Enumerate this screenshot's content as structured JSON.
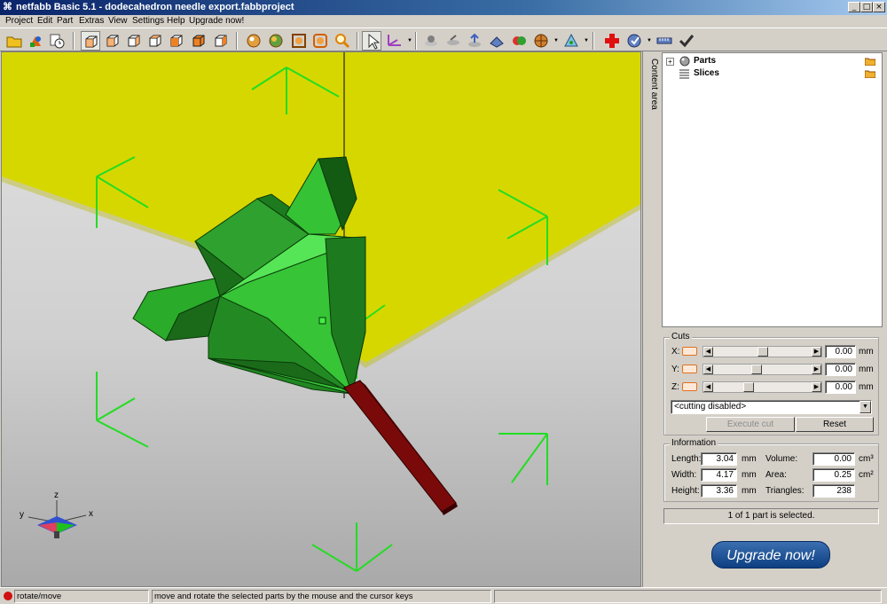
{
  "window": {
    "title": "netfabb Basic 5.1 - dodecahedron needle export.fabbproject",
    "app_icon": "netfabb-logo-icon",
    "controls": [
      "_",
      "□",
      "×"
    ]
  },
  "menu": [
    "Project",
    "Edit",
    "Part",
    "Extras",
    "View",
    "Settings",
    "Help",
    "Upgrade now!"
  ],
  "toolbar": {
    "icons": [
      "open-project-icon",
      "add-part-icon",
      "project-info-icon",
      "view-3d-icon",
      "view-front-icon",
      "view-back-icon",
      "view-left-icon",
      "view-right-icon",
      "view-top-icon",
      "view-bottom-icon",
      "shading-icon",
      "texture-icon",
      "zoom-fit-icon",
      "zoom-selection-icon",
      "zoom-icon",
      "select-cursor-icon",
      "rotate-move-icon",
      "measure-icon",
      "rotate-part-icon",
      "align-icon",
      "slice-icon",
      "color-icon",
      "section-icon",
      "mesh-icon",
      "repair-icon",
      "analyze-icon",
      "ruler-icon",
      "checkmark-icon"
    ]
  },
  "viewport": {
    "axis_labels": {
      "x": "x",
      "y": "y",
      "z": "z"
    },
    "colors": {
      "platform": "#d7d700",
      "part_green": "#2a9a2a",
      "needle": "#7a0a0a",
      "grid_lines": "#22dd22"
    }
  },
  "content_tab": {
    "label": "Content area"
  },
  "tree": {
    "items": [
      {
        "label": "Parts",
        "expander": "+",
        "icon": "parts-icon"
      },
      {
        "label": "Slices",
        "expander": "",
        "icon": "slices-icon"
      }
    ]
  },
  "cuts": {
    "title": "Cuts",
    "rows": [
      {
        "axis": "X:",
        "value": "0.00",
        "unit": "mm",
        "thumb_fraction": 0.5
      },
      {
        "axis": "Y:",
        "value": "0.00",
        "unit": "mm",
        "thumb_fraction": 0.45
      },
      {
        "axis": "Z:",
        "value": "0.00",
        "unit": "mm",
        "thumb_fraction": 0.38
      }
    ],
    "mode": "<cutting disabled>",
    "execute_label": "Execute cut",
    "reset_label": "Reset"
  },
  "information": {
    "title": "Information",
    "length_label": "Length:",
    "length_value": "3.04",
    "length_unit": "mm",
    "width_label": "Width:",
    "width_value": "4.17",
    "width_unit": "mm",
    "height_label": "Height:",
    "height_value": "3.36",
    "height_unit": "mm",
    "volume_label": "Volume:",
    "volume_value": "0.00",
    "volume_unit": "cm³",
    "area_label": "Area:",
    "area_value": "0.25",
    "area_unit": "cm²",
    "triangles_label": "Triangles:",
    "triangles_value": "238"
  },
  "selection_status": "1 of 1 part is selected.",
  "upgrade_button": "Upgrade now!",
  "statusbar": {
    "mode": "rotate/move",
    "hint": "move and rotate the selected parts by the mouse and the cursor keys"
  }
}
